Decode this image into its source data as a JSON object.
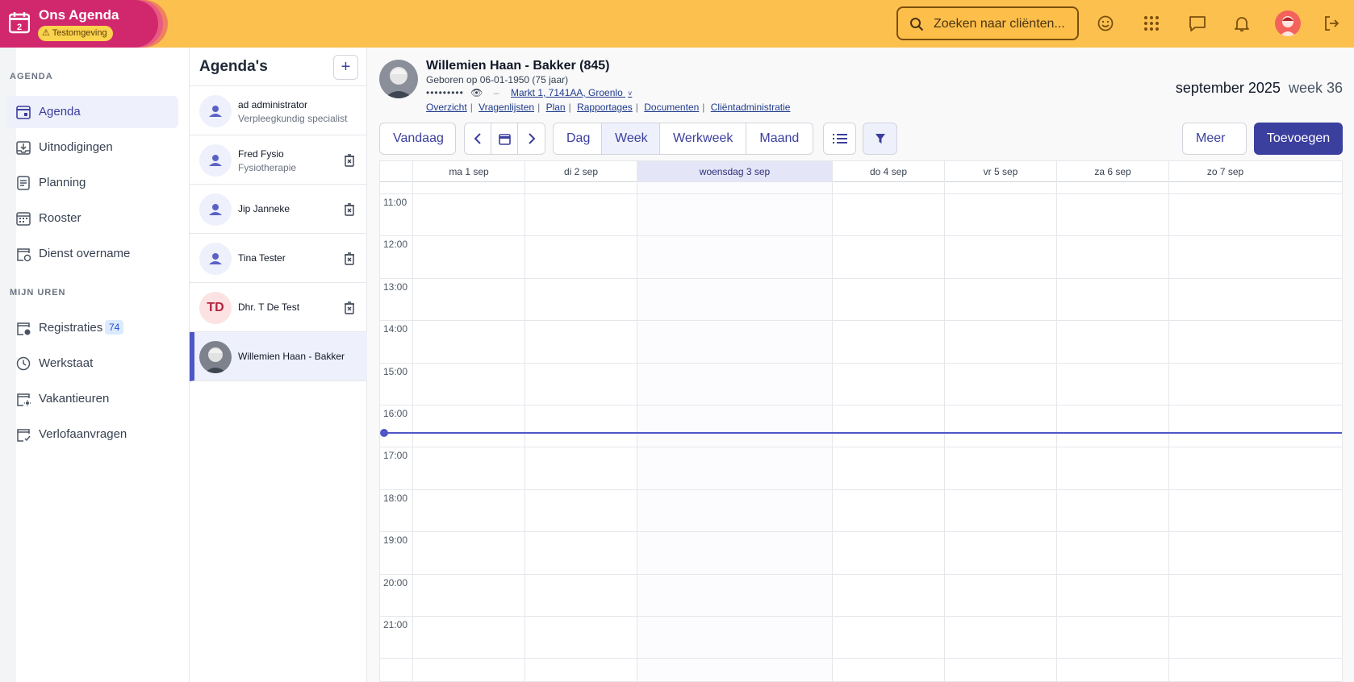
{
  "app": {
    "title": "Ons Agenda",
    "environment_badge": "Testomgeving",
    "brand_colors": {
      "primary": "#3b3f9e",
      "topbar": "#fcc04f",
      "brand": "#d1286d"
    }
  },
  "topbar": {
    "search_placeholder": "Zoeken naar cliënten...",
    "icons": [
      "smiley-icon",
      "apps-grid-icon",
      "chat-icon",
      "bell-icon",
      "user-avatar",
      "logout-icon"
    ]
  },
  "sidebar": {
    "section_agenda": "AGENDA",
    "section_hours": "MIJN UREN",
    "items": [
      {
        "label": "Agenda",
        "icon": "calendar-icon",
        "active": true
      },
      {
        "label": "Uitnodigingen",
        "icon": "inbox-download-icon"
      },
      {
        "label": "Planning",
        "icon": "planning-icon"
      },
      {
        "label": "Rooster",
        "icon": "roster-icon"
      },
      {
        "label": "Dienst overname",
        "icon": "shift-swap-icon"
      }
    ],
    "hours_items": [
      {
        "label": "Registraties",
        "icon": "registration-icon",
        "badge": "74"
      },
      {
        "label": "Werkstaat",
        "icon": "clock-icon"
      },
      {
        "label": "Vakantieuren",
        "icon": "vacation-icon"
      },
      {
        "label": "Verlofaanvragen",
        "icon": "leave-request-icon"
      }
    ]
  },
  "agendas": {
    "title": "Agenda's",
    "add_label": "+",
    "list": [
      {
        "name": "ad administrator",
        "role": "Verpleegkundig specialist"
      },
      {
        "name": "Fred Fysio",
        "role": "Fysiotherapie"
      },
      {
        "name": "Jip Janneke",
        "role": ""
      },
      {
        "name": "Tina Tester",
        "role": ""
      },
      {
        "name": "Dhr. T De Test",
        "initials": "TD",
        "role": ""
      },
      {
        "name": "Willemien Haan - Bakker",
        "role": "",
        "active": true
      }
    ]
  },
  "client": {
    "name": "Willemien Haan - Bakker (845)",
    "born": "Geboren op 06-01-1950 (75 jaar)",
    "bsn_masked": "•••••••••",
    "address": "Markt 1, 7141AA, Groenlo",
    "links": [
      "Overzicht",
      "Vragenlijsten",
      "Plan",
      "Rapportages",
      "Documenten",
      "Cliëntadministratie"
    ]
  },
  "period": {
    "month": "september 2025",
    "week": "week 36"
  },
  "toolbar": {
    "today": "Vandaag",
    "views": [
      "Dag",
      "Week",
      "Werkweek",
      "Maand"
    ],
    "active_view": "Week",
    "more": "Meer",
    "add": "Toevoegen"
  },
  "calendar": {
    "days": [
      "ma 1 sep",
      "di 2 sep",
      "woensdag 3 sep",
      "do 4 sep",
      "vr 5 sep",
      "za 6 sep",
      "zo 7 sep"
    ],
    "today_index": 2,
    "hours": [
      "11:00",
      "12:00",
      "13:00",
      "14:00",
      "15:00",
      "16:00",
      "17:00",
      "18:00",
      "19:00",
      "20:00",
      "21:00"
    ],
    "now_time": "16:40"
  }
}
